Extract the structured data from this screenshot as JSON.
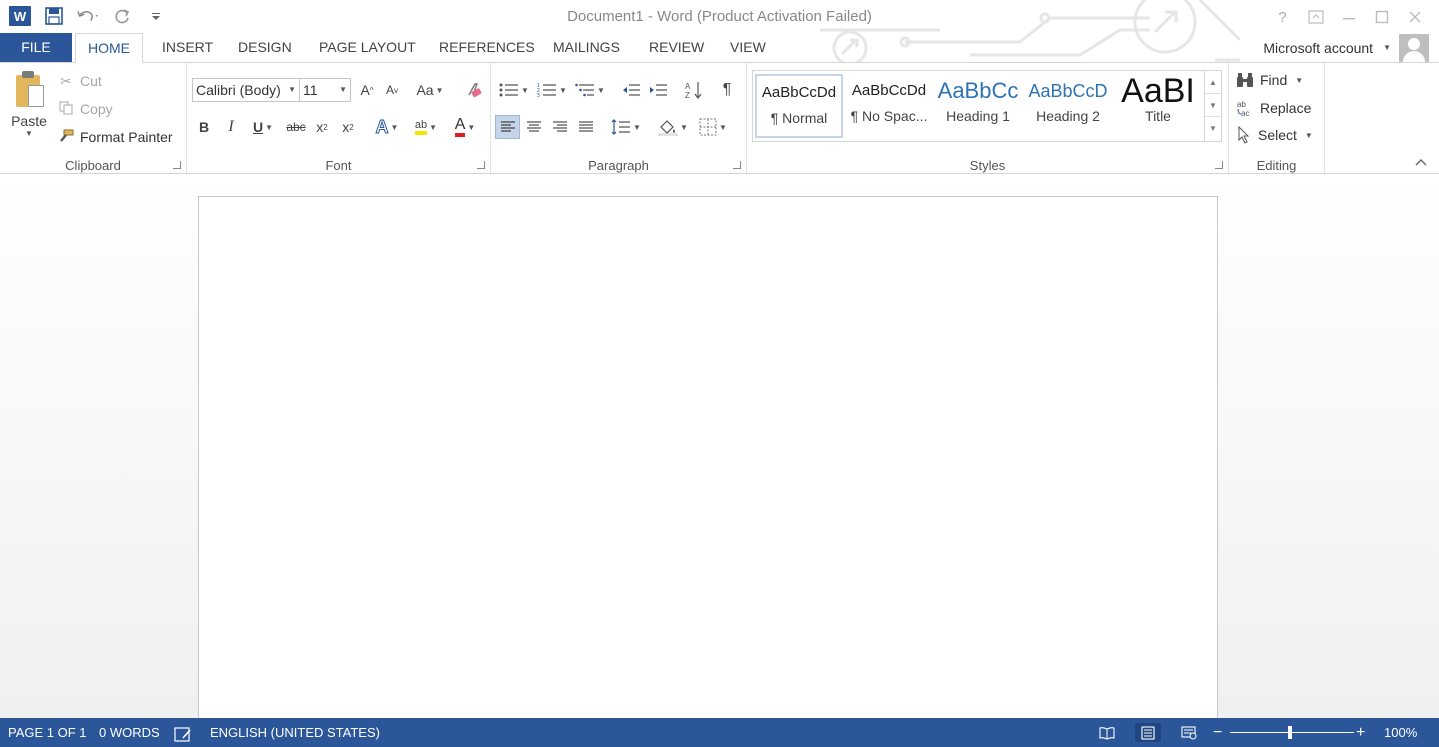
{
  "titlebar": {
    "title": "Document1 - Word (Product Activation Failed)",
    "app_logo_letter": "W",
    "help_icon": "?"
  },
  "tabs": [
    "FILE",
    "HOME",
    "INSERT",
    "DESIGN",
    "PAGE LAYOUT",
    "REFERENCES",
    "MAILINGS",
    "REVIEW",
    "VIEW"
  ],
  "account": {
    "label": "Microsoft account"
  },
  "ribbon": {
    "clipboard": {
      "label": "Clipboard",
      "paste": "Paste",
      "cut": "Cut",
      "copy": "Copy",
      "format_painter": "Format Painter"
    },
    "font": {
      "label": "Font",
      "font_name": "Calibri (Body)",
      "font_size": "11",
      "grow": "A",
      "shrink": "A",
      "change_case": "Aa",
      "bold": "B",
      "italic": "I",
      "underline": "U",
      "strike": "abc",
      "subscript": "x",
      "superscript": "x",
      "text_effects": "A",
      "highlight": "ab",
      "font_color": "A",
      "highlight_color": "#f5e600",
      "font_color_value": "#e02020"
    },
    "paragraph": {
      "label": "Paragraph",
      "pilcrow": "¶"
    },
    "styles": {
      "label": "Styles",
      "items": [
        {
          "sample": "AaBbCcDd",
          "name": "¶ Normal"
        },
        {
          "sample": "AaBbCcDd",
          "name": "¶ No Spac..."
        },
        {
          "sample": "AaBbCc",
          "name": "Heading 1"
        },
        {
          "sample": "AaBbCcD",
          "name": "Heading 2"
        },
        {
          "sample": "AaBI",
          "name": "Title"
        }
      ]
    },
    "editing": {
      "label": "Editing",
      "find": "Find",
      "replace": "Replace",
      "select": "Select"
    }
  },
  "status": {
    "page": "PAGE 1 OF 1",
    "words": "0 WORDS",
    "language": "ENGLISH (UNITED STATES)",
    "zoom": "100%",
    "zoom_minus": "−",
    "zoom_plus": "+"
  },
  "colors": {
    "accent": "#2b579a"
  }
}
